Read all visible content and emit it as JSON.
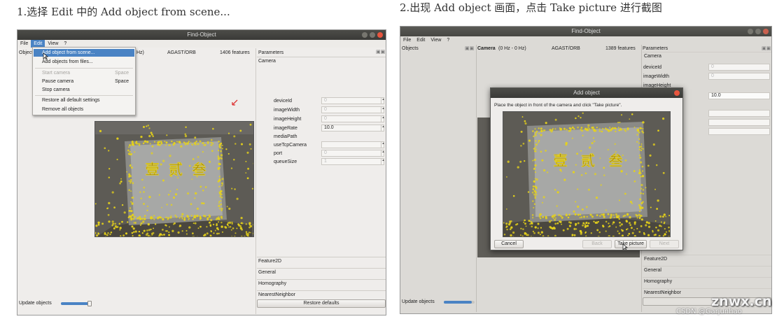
{
  "captions": {
    "step1": "1.选择 Edit 中的 Add object from scene...",
    "step2": "2.出现 Add object 画面，点击 Take picture 进行截图"
  },
  "watermark": {
    "brand": "znwx.cn",
    "credit": "CSDN @Garjunhao"
  },
  "left": {
    "title": "Find-Object",
    "menu": [
      "File",
      "Edit",
      "View",
      "?"
    ],
    "objects_label": "Objects",
    "hz": "Hz)",
    "detector": "AGAST/ORB",
    "features": "1406 features",
    "params_label": "Parameters",
    "camera_section": "Camera",
    "params": [
      {
        "name": "deviceId",
        "value": "0"
      },
      {
        "name": "imageWidth",
        "value": "0"
      },
      {
        "name": "imageHeight",
        "value": "0"
      },
      {
        "name": "imageRate",
        "value": "10.0"
      },
      {
        "name": "mediaPath",
        "value": ""
      },
      {
        "name": "useTcpCamera",
        "value": ""
      },
      {
        "name": "port",
        "value": "0"
      },
      {
        "name": "queueSize",
        "value": "1"
      }
    ],
    "sections": [
      "Feature2D",
      "General",
      "Homography",
      "NearestNeighbor"
    ],
    "restore_defaults": "Restore defaults",
    "update_objects": "Update objects",
    "edit_menu": {
      "items": [
        {
          "label": "Add object from scene...",
          "shortcut": "",
          "state": "highlight"
        },
        {
          "label": "Add objects from files...",
          "shortcut": "",
          "state": "normal"
        },
        {
          "label": "Start camera",
          "shortcut": "Space",
          "state": "disabled"
        },
        {
          "label": "Pause camera",
          "shortcut": "Space",
          "state": "normal"
        },
        {
          "label": "Stop camera",
          "shortcut": "",
          "state": "normal"
        },
        {
          "label": "Restore all default settings",
          "shortcut": "",
          "state": "normal"
        },
        {
          "label": "Remove all objects",
          "shortcut": "",
          "state": "normal"
        }
      ]
    },
    "object_chars": [
      "壹",
      "贰",
      "叁"
    ]
  },
  "right": {
    "title": "Find-Object",
    "menu": [
      "File",
      "Edit",
      "View",
      "?"
    ],
    "objects_label": "Objects",
    "camera_label": "Camera",
    "hz": "(0 Hz - 0 Hz)",
    "detector": "AGAST/ORB",
    "features": "1389 features",
    "params_label": "Parameters",
    "camera_section": "Camera",
    "params": [
      {
        "name": "deviceId",
        "value": "0"
      },
      {
        "name": "imageWidth",
        "value": "0"
      },
      {
        "name": "imageHeight",
        "value": ""
      }
    ],
    "image_rate": "10.0",
    "sections": [
      "Feature2D",
      "General",
      "Homography",
      "NearestNeighbor"
    ],
    "update_objects": "Update objects",
    "dialog": {
      "title": "Add object",
      "instruction": "Place the object in front of the camera and click \"Take picture\".",
      "cancel": "Cancel",
      "back": "Back",
      "take_picture": "Take picture",
      "next": "Next"
    },
    "object_chars": [
      "壹",
      "贰",
      "叁"
    ]
  },
  "colors": {
    "accent": "#4a83c4",
    "feature_points": "#e6d21a",
    "titlebar": "#3e3e3b",
    "close": "#e8553e"
  }
}
